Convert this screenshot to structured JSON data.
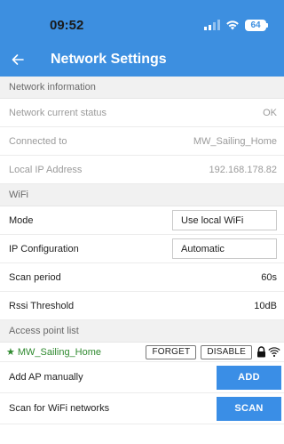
{
  "status_bar": {
    "time": "09:52",
    "battery": "64"
  },
  "app_bar": {
    "title": "Network Settings",
    "back_icon": "arrow-left-icon"
  },
  "sections": {
    "network_info": {
      "header": "Network information",
      "rows": [
        {
          "label": "Network current status",
          "value": "OK"
        },
        {
          "label": "Connected to",
          "value": "MW_Sailing_Home"
        },
        {
          "label": "Local IP Address",
          "value": "192.168.178.82"
        }
      ]
    },
    "wifi": {
      "header": "WiFi",
      "mode": {
        "label": "Mode",
        "value": "Use local WiFi"
      },
      "ip_config": {
        "label": "IP Configuration",
        "value": "Automatic"
      },
      "scan_period": {
        "label": "Scan period",
        "value": "60s"
      },
      "rssi": {
        "label": "Rssi Threshold",
        "value": "10dB"
      }
    },
    "access_points": {
      "header": "Access point list",
      "items": [
        {
          "star": "★",
          "name": "MW_Sailing_Home",
          "forget": "FORGET",
          "disable": "DISABLE"
        }
      ],
      "add": {
        "label": "Add AP manually",
        "button": "ADD"
      },
      "scan": {
        "label": "Scan for WiFi networks",
        "button": "SCAN"
      }
    }
  },
  "colors": {
    "accent": "#3d8fe0",
    "button": "#3a8ee6",
    "connected": "#2f8a2f",
    "section_bg": "#f1f1f1"
  }
}
